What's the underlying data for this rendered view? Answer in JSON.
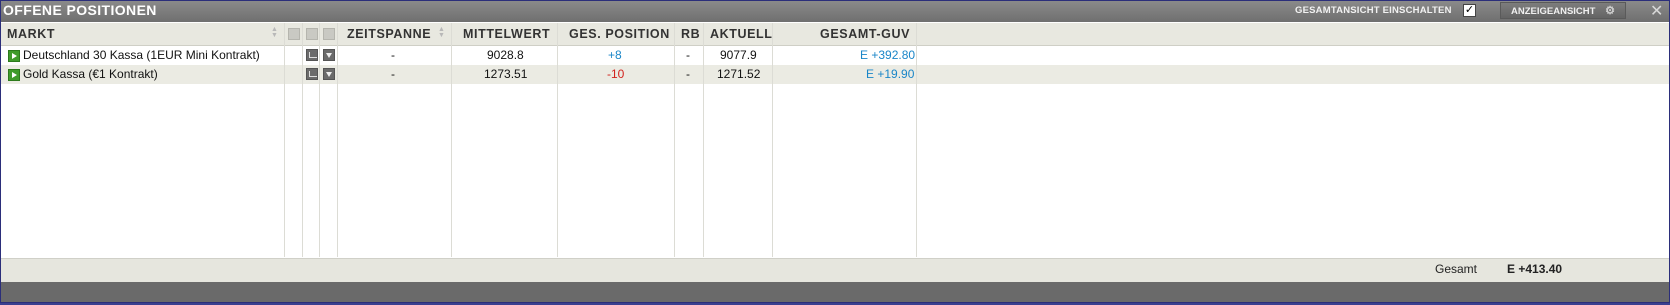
{
  "window": {
    "title": "OFFENE POSITIONEN",
    "overview_label": "GESAMTANSICHT EINSCHALTEN",
    "overview_checked": true,
    "view_button": "ANZEIGEANSICHT",
    "close_glyph": "✕",
    "gear_glyph": "⚙"
  },
  "columns": {
    "markt": "MARKT",
    "zeitspanne": "ZEITSPANNE",
    "mittelwert": "MITTELWERT",
    "ges_position": "GES. POSITION",
    "rb": "RB",
    "aktuell": "AKTUELL",
    "gesamt_guv": "GESAMT-GUV"
  },
  "rows": [
    {
      "markt": "Deutschland 30 Kassa (1EUR Mini Kontrakt)",
      "zeitspanne": "-",
      "mittelwert": "9028.8",
      "ges_position": "+8",
      "rb": "-",
      "aktuell": "9077.9",
      "gesamt_guv": "E +392.80"
    },
    {
      "markt": "Gold Kassa (€1 Kontrakt)",
      "zeitspanne": "-",
      "mittelwert": "1273.51",
      "ges_position": "-10",
      "rb": "-",
      "aktuell": "1271.52",
      "gesamt_guv": "E +19.90"
    }
  ],
  "footer": {
    "label": "Gesamt",
    "value": "E +413.40"
  },
  "colors": {
    "positive": "#1a86c8",
    "negative": "#d2231e",
    "play": "#3f9b2a"
  }
}
